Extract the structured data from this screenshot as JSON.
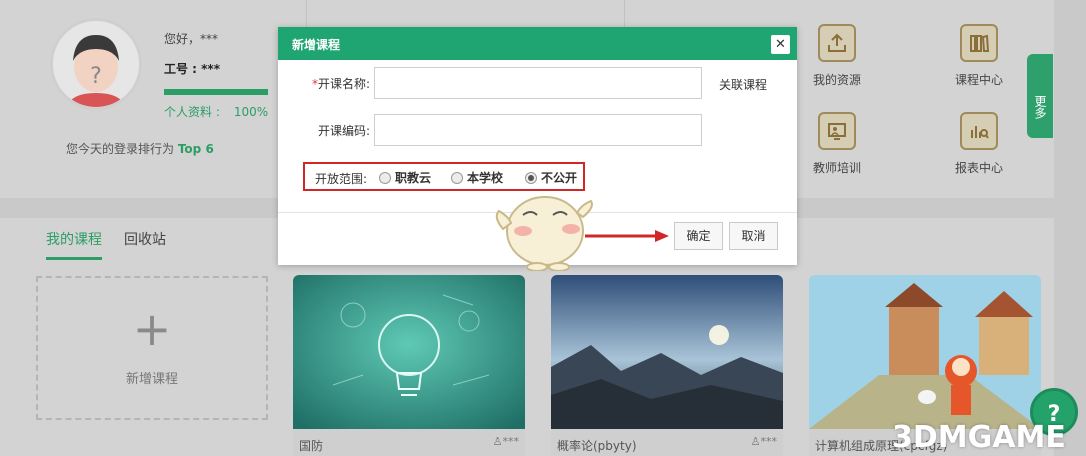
{
  "profile": {
    "greeting": "您好，***",
    "job_number": "工号 : ***",
    "profile_label": "个人资料 :",
    "profile_percent": "100%",
    "profile_completion": 100,
    "rank_prefix": "您今天的登录排行为",
    "rank_value": "Top 6"
  },
  "quick_links": {
    "my_resources": "我的资源",
    "course_center": "课程中心",
    "teacher_training": "教师培训",
    "report_center": "报表中心",
    "more": "更多"
  },
  "course_tabs": {
    "my_courses": "我的课程",
    "recycle_bin": "回收站"
  },
  "add_course": {
    "plus": "+",
    "label": "新增课程"
  },
  "cards": [
    {
      "title": "国防",
      "owner": "***"
    },
    {
      "title": "概率论(pbyty)",
      "owner": "***"
    },
    {
      "title": "计算机组成原理(cpcfgz)",
      "owner": "***"
    }
  ],
  "help_button": "?",
  "modal": {
    "title": "新增课程",
    "close": "✕",
    "required_mark": "*",
    "name_label": "开课名称:",
    "name_value": "",
    "link_course": "关联课程",
    "code_label": "开课编码:",
    "code_value": "",
    "scope_label": "开放范围:",
    "scope_options": [
      "职教云",
      "本学校",
      "不公开"
    ],
    "scope_selected": "不公开",
    "confirm": "确定",
    "cancel": "取消"
  },
  "watermark": "3DMGAME",
  "colors": {
    "primary_green": "#1fa572",
    "highlight_red": "#d02828"
  }
}
